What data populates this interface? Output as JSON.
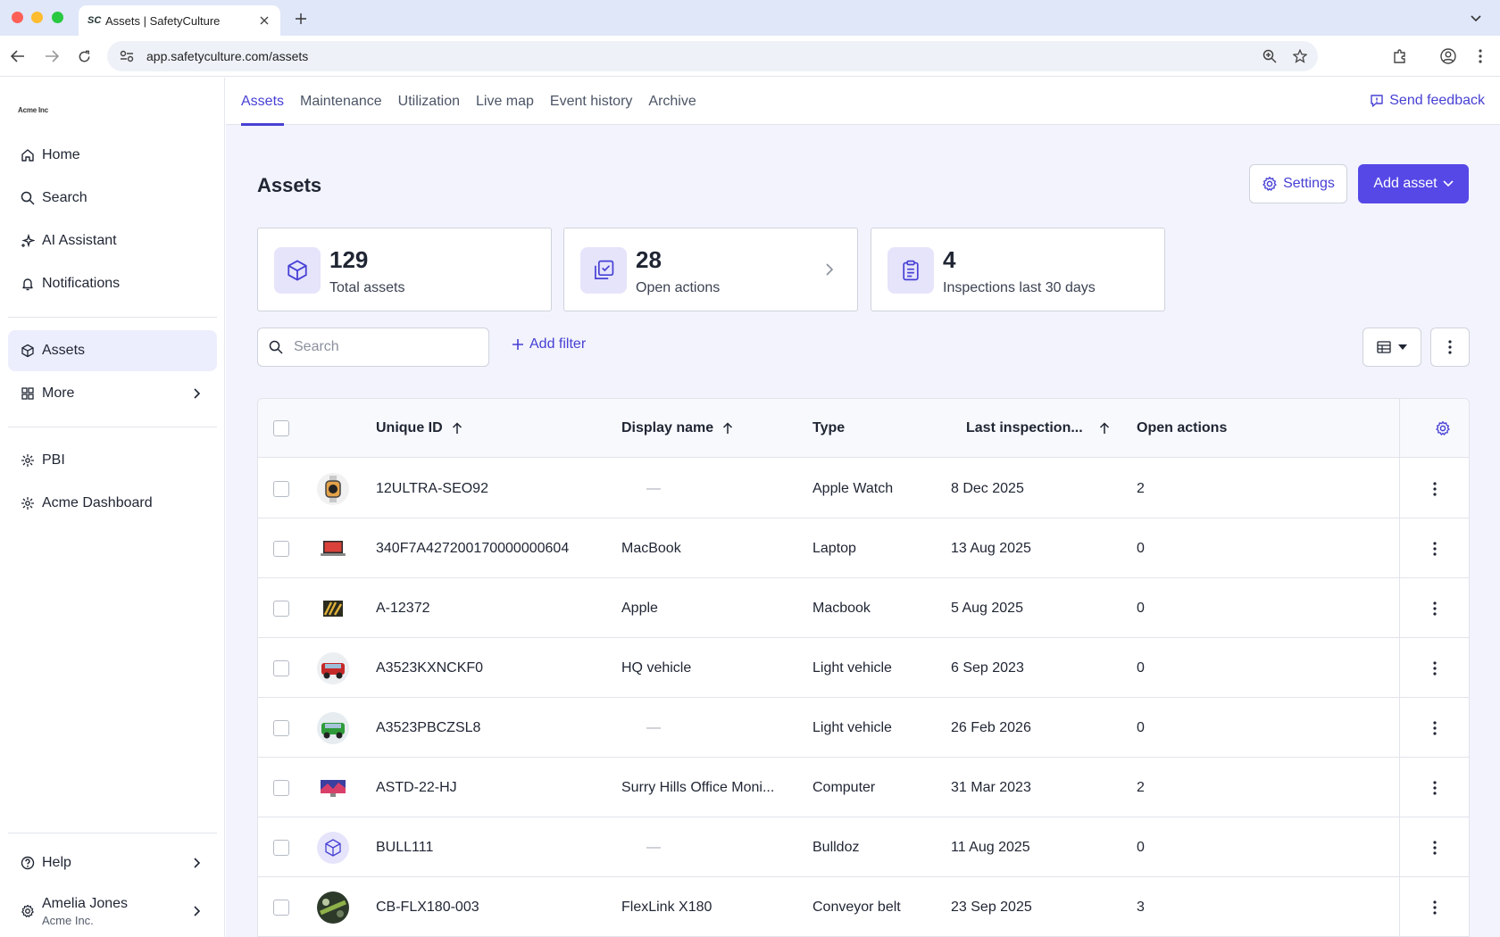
{
  "browser": {
    "tab_favicon": "SC",
    "tab_title": "Assets | SafetyCulture",
    "url": "app.safetyculture.com/assets"
  },
  "sidebar": {
    "logo": "Acme Inc",
    "items": [
      {
        "label": "Home",
        "icon": "home-icon"
      },
      {
        "label": "Search",
        "icon": "search-icon"
      },
      {
        "label": "AI Assistant",
        "icon": "sparkle-icon"
      },
      {
        "label": "Notifications",
        "icon": "bell-icon"
      },
      {
        "label": "Assets",
        "icon": "cube-icon",
        "active": true
      },
      {
        "label": "More",
        "icon": "grid-icon"
      }
    ],
    "secondary": [
      {
        "label": "PBI",
        "icon": "puzzle-icon"
      },
      {
        "label": "Acme Dashboard",
        "icon": "puzzle-icon"
      }
    ],
    "help": "Help",
    "user_name": "Amelia Jones",
    "user_org": "Acme Inc."
  },
  "subnav": {
    "tabs": [
      "Assets",
      "Maintenance",
      "Utilization",
      "Live map",
      "Event history",
      "Archive"
    ],
    "feedback": "Send feedback"
  },
  "page": {
    "title": "Assets",
    "settings": "Settings",
    "add_asset": "Add asset"
  },
  "stats": [
    {
      "value": "129",
      "label": "Total assets",
      "icon": "cube-icon"
    },
    {
      "value": "28",
      "label": "Open actions",
      "icon": "actions-icon"
    },
    {
      "value": "4",
      "label": "Inspections last 30 days",
      "icon": "clipboard-icon"
    }
  ],
  "search": {
    "placeholder": "Search"
  },
  "add_filter": "Add filter",
  "table": {
    "columns": [
      "Unique ID",
      "Display name",
      "Type",
      "Last inspection...",
      "Open actions"
    ],
    "rows": [
      {
        "id": "12ULTRA-SEO92",
        "name": "—",
        "type": "Apple Watch",
        "last": "8 Dec 2025",
        "actions": "2",
        "thumb": "watch"
      },
      {
        "id": "340F7A427200170000000604",
        "name": "MacBook",
        "type": "Laptop",
        "last": "13 Aug 2025",
        "actions": "0",
        "thumb": "laptop"
      },
      {
        "id": "A-12372",
        "name": "Apple",
        "type": "Macbook",
        "last": "5 Aug 2025",
        "actions": "0",
        "thumb": "sign"
      },
      {
        "id": "A3523KXNCKF0",
        "name": "HQ vehicle",
        "type": "Light vehicle",
        "last": "6 Sep 2023",
        "actions": "0",
        "thumb": "redcar"
      },
      {
        "id": "A3523PBCZSL8",
        "name": "—",
        "type": "Light vehicle",
        "last": "26 Feb 2026",
        "actions": "0",
        "thumb": "greencar"
      },
      {
        "id": "ASTD-22-HJ",
        "name": "Surry Hills Office Moni...",
        "type": "Computer",
        "last": "31 Mar 2023",
        "actions": "2",
        "thumb": "monitor"
      },
      {
        "id": "BULL111",
        "name": "—",
        "type": "Bulldoz",
        "last": "11 Aug 2025",
        "actions": "0",
        "thumb": "cube"
      },
      {
        "id": "CB-FLX180-003",
        "name": "FlexLink X180",
        "type": "Conveyor belt",
        "last": "23 Sep 2025",
        "actions": "3",
        "thumb": "belt"
      }
    ]
  },
  "colors": {
    "accent": "#5648e6",
    "link": "#4740d4",
    "bg": "#f2f3fc"
  }
}
